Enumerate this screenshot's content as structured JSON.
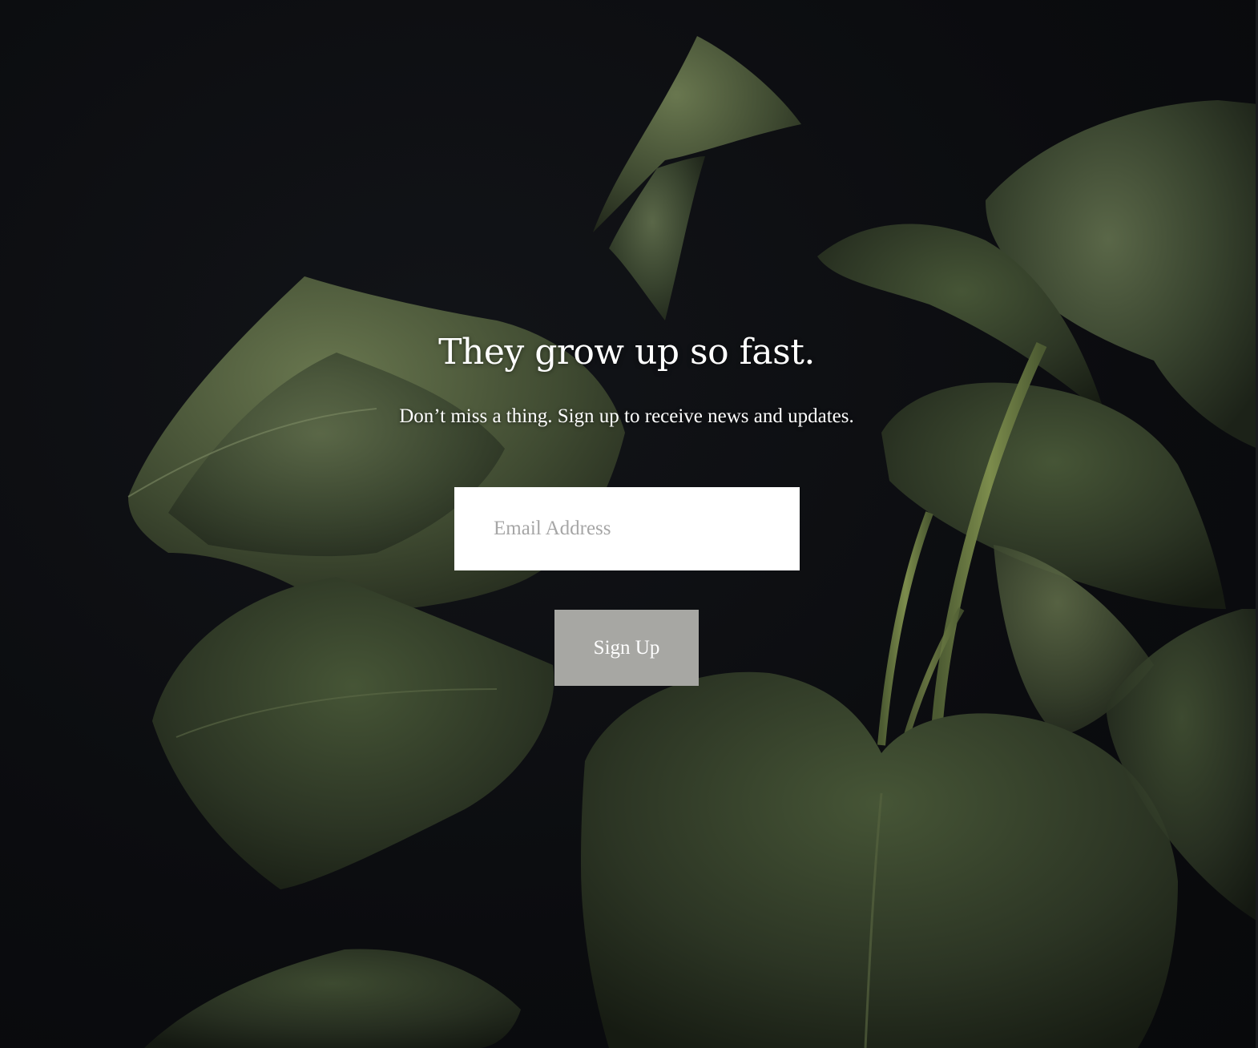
{
  "newsletter": {
    "headline": "They grow up so fast.",
    "subheadline": "Don’t miss a thing. Sign up to receive news and updates.",
    "email_placeholder": "Email Address",
    "email_value": "",
    "submit_label": "Sign Up"
  },
  "background": {
    "image_subject": "monstera-leaves-photo",
    "background_color": "#0c0d10",
    "leaf_color": "#3a4530"
  },
  "colors": {
    "button_background": "#a7a7a3",
    "text": "#ffffff",
    "input_background": "#ffffff",
    "placeholder": "#a6a6a6"
  }
}
